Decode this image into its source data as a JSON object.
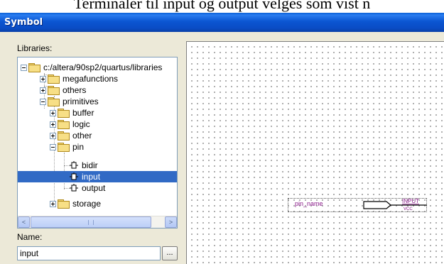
{
  "caption": "Terminaler til input og output velges som vist n",
  "window": {
    "title": "Symbol"
  },
  "libraries": {
    "label": "Libraries:",
    "tree": [
      {
        "label": "c:/altera/90sp2/quartus/libraries",
        "kind": "folder-open",
        "expander": "minus"
      },
      {
        "label": "megafunctions",
        "kind": "folder",
        "expander": "plus"
      },
      {
        "label": "others",
        "kind": "folder",
        "expander": "plus"
      },
      {
        "label": "primitives",
        "kind": "folder-open",
        "expander": "minus"
      },
      {
        "label": "buffer",
        "kind": "folder",
        "expander": "plus"
      },
      {
        "label": "logic",
        "kind": "folder",
        "expander": "plus"
      },
      {
        "label": "other",
        "kind": "folder",
        "expander": "plus"
      },
      {
        "label": "pin",
        "kind": "folder-open",
        "expander": "minus"
      },
      {
        "label": "bidir",
        "kind": "pin"
      },
      {
        "label": "input",
        "kind": "pin",
        "selected": true
      },
      {
        "label": "output",
        "kind": "pin"
      },
      {
        "label": "storage",
        "kind": "folder",
        "expander": "plus"
      }
    ]
  },
  "scrollbar": {
    "left_arrow": "<",
    "right_arrow": ">"
  },
  "name_field": {
    "label": "Name:",
    "value": "input",
    "browse_label": "..."
  },
  "preview": {
    "pin_name": "pin_name",
    "symbol_label": "INPUT",
    "symbol_sublabel": "VCC"
  },
  "colors": {
    "title_bar": "#0a55d0",
    "selection": "#316ac5",
    "symbol_text": "#8a1a8a"
  }
}
